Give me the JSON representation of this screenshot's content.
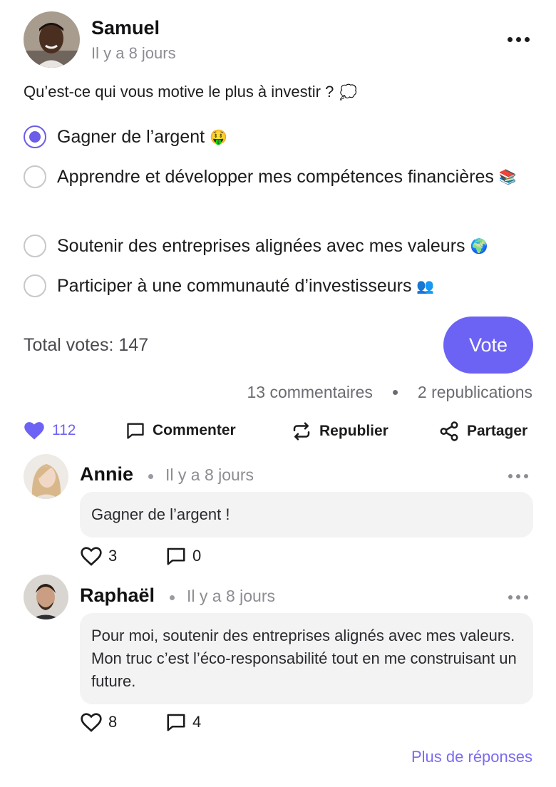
{
  "post": {
    "author": "Samuel",
    "time": "Il y a 8 jours",
    "question": "Qu’est-ce qui vous motive le plus à investir ?",
    "question_emoji": "💭",
    "options": [
      {
        "text": "Gagner de l’argent",
        "emoji": "🤑",
        "selected": true
      },
      {
        "text": "Apprendre et développer mes compétences financières",
        "emoji": "📚",
        "selected": false
      },
      {
        "text": "Soutenir des entreprises alignées avec mes valeurs",
        "emoji": "🌍",
        "selected": false
      },
      {
        "text": "Participer à une communauté d’investisseurs",
        "emoji": "👥",
        "selected": false
      }
    ],
    "total_votes": "Total votes: 147",
    "vote_label": "Vote",
    "comments_count": "13 commentaires",
    "reposts_count": "2 republications",
    "likes": "112",
    "actions": {
      "comment": "Commenter",
      "repost": "Republier",
      "share": "Partager"
    }
  },
  "comments": [
    {
      "author": "Annie",
      "time": "Il y a 8 jours",
      "text": "Gagner de l’argent !",
      "likes": "3",
      "replies": "0"
    },
    {
      "author": "Raphaël",
      "time": "Il y a 8 jours",
      "text": "Pour moi, soutenir des entreprises alignés avec mes valeurs. Mon truc c’est l’éco-responsabilité tout en me construisant un future.",
      "likes": "8",
      "replies": "4"
    }
  ],
  "more_replies": "Plus de réponses",
  "colors": {
    "accent": "#6c63f4",
    "muted": "#8c8c93",
    "bubble": "#f3f3f4"
  },
  "icons": [
    "more-horizontal-icon",
    "heart-icon",
    "comment-icon",
    "repost-icon",
    "share-icon"
  ]
}
